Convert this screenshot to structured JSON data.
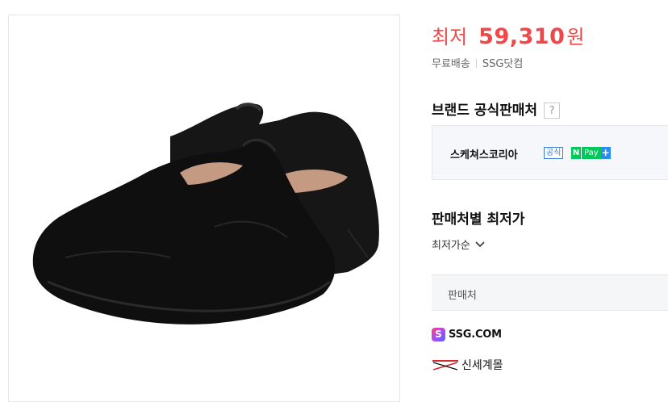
{
  "product": {
    "image_alt": "Black slip-on shoes",
    "price_label": "최저",
    "price_value": "59,310",
    "price_unit": "원",
    "shipping": "무료배송",
    "seller": "SSG닷컴"
  },
  "brand_section": {
    "title": "브랜드 공식판매처",
    "help": "?",
    "store_name": "스케쳐스코리아",
    "official_badge": "공식",
    "npay_n": "N",
    "npay_text": "Pay",
    "npay_plus": "+"
  },
  "seller_section": {
    "title": "판매처별 최저가",
    "sort_label": "최저가순",
    "column_header": "판매처",
    "malls": [
      {
        "name": "SSG.COM",
        "icon_letter": "S"
      },
      {
        "name": "신세계몰",
        "icon_letter": "SSG"
      }
    ]
  },
  "colors": {
    "price": "#f04848",
    "npay_green": "#03c75a",
    "official_blue": "#3a7bd5"
  }
}
